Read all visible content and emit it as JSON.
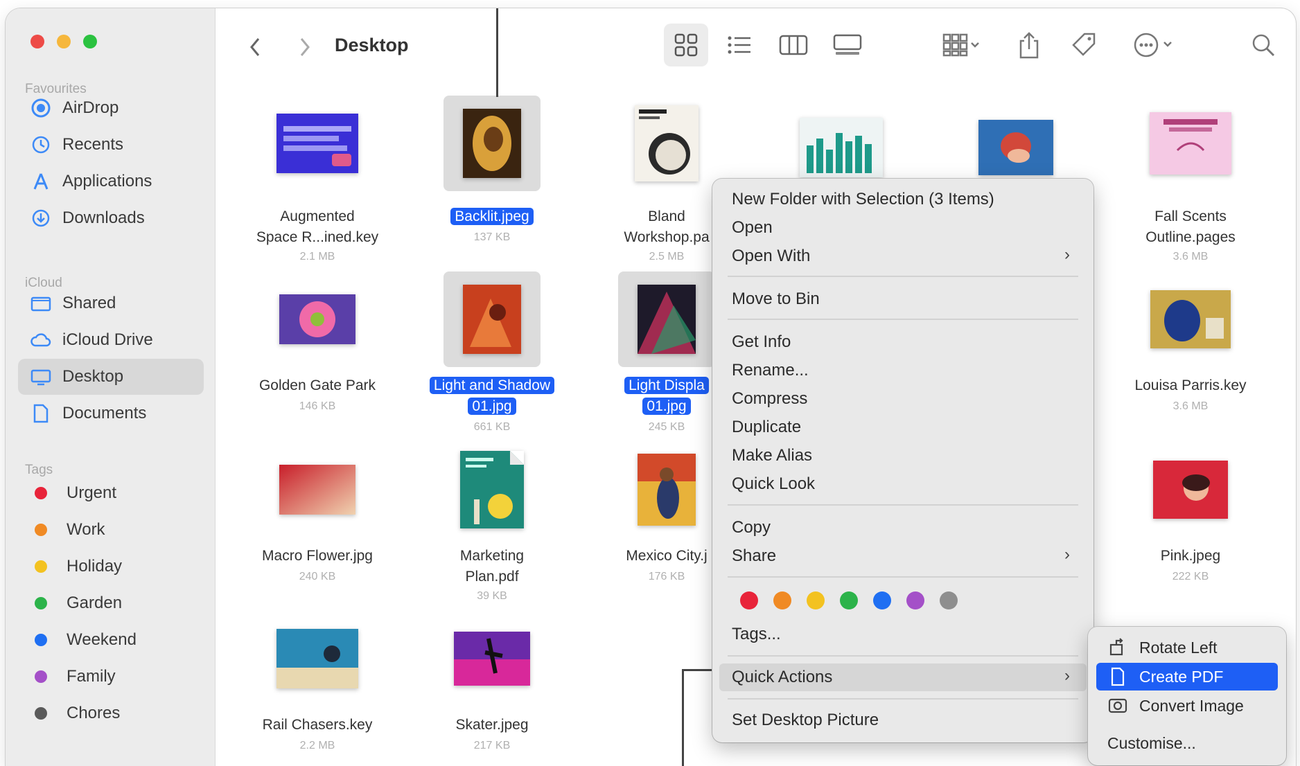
{
  "window": {
    "title": "Desktop",
    "traffic_lights": [
      "#ed4b47",
      "#f6b73c",
      "#2bc240"
    ]
  },
  "sidebar": {
    "favourites_heading": "Favourites",
    "favourites": [
      {
        "label": "AirDrop",
        "icon": "airdrop-icon"
      },
      {
        "label": "Recents",
        "icon": "clock-icon"
      },
      {
        "label": "Applications",
        "icon": "applications-icon"
      },
      {
        "label": "Downloads",
        "icon": "download-icon"
      }
    ],
    "icloud_heading": "iCloud",
    "icloud": [
      {
        "label": "Shared",
        "icon": "shared-folder-icon"
      },
      {
        "label": "iCloud Drive",
        "icon": "cloud-icon"
      },
      {
        "label": "Desktop",
        "icon": "desktop-icon",
        "selected": true
      },
      {
        "label": "Documents",
        "icon": "document-icon"
      }
    ],
    "tags_heading": "Tags",
    "tags": [
      {
        "label": "Urgent",
        "color": "#e8243a"
      },
      {
        "label": "Work",
        "color": "#f08a24"
      },
      {
        "label": "Holiday",
        "color": "#f3c220"
      },
      {
        "label": "Garden",
        "color": "#2cb34a"
      },
      {
        "label": "Weekend",
        "color": "#1f6ff2"
      },
      {
        "label": "Family",
        "color": "#a450c8"
      },
      {
        "label": "Chores",
        "color": "#5a5a5a"
      }
    ]
  },
  "files": [
    {
      "name": "Augmented Space R...ined.key",
      "name_lines": [
        "Augmented",
        "Space R...ined.key"
      ],
      "size": "2.1 MB",
      "selected": false
    },
    {
      "name": "Backlit.jpeg",
      "name_lines": [
        "Backlit.jpeg"
      ],
      "size": "137 KB",
      "selected": true
    },
    {
      "name": "Bland Workshop.pa",
      "name_lines": [
        "Bland",
        "Workshop.pa"
      ],
      "size": "2.5 MB",
      "selected": false
    },
    {
      "name": "Fall Scents Outline.pages",
      "name_lines": [
        "Fall Scents",
        "Outline.pages"
      ],
      "size": "3.6 MB",
      "selected": false
    },
    {
      "name": "Golden Gate Park",
      "name_lines": [
        "Golden Gate Park"
      ],
      "size": "146 KB",
      "selected": false
    },
    {
      "name": "Light and Shadow 01.jpg",
      "name_lines": [
        "Light and Shadow",
        "01.jpg"
      ],
      "size": "661 KB",
      "selected": true
    },
    {
      "name": "Light Displa 01.jpg",
      "name_lines": [
        "Light Displa",
        "01.jpg"
      ],
      "size": "245 KB",
      "selected": true
    },
    {
      "name": "Louisa Parris.key",
      "name_lines": [
        "Louisa Parris.key"
      ],
      "size": "3.6 MB",
      "selected": false
    },
    {
      "name": "Macro Flower.jpg",
      "name_lines": [
        "Macro Flower.jpg"
      ],
      "size": "240 KB",
      "selected": false
    },
    {
      "name": "Marketing Plan.pdf",
      "name_lines": [
        "Marketing",
        "Plan.pdf"
      ],
      "size": "39 KB",
      "selected": false
    },
    {
      "name": "Mexico City.j",
      "name_lines": [
        "Mexico City.j"
      ],
      "size": "176 KB",
      "selected": false
    },
    {
      "name": "Pink.jpeg",
      "name_lines": [
        "Pink.jpeg"
      ],
      "size": "222 KB",
      "selected": false
    },
    {
      "name": "Rail Chasers.key",
      "name_lines": [
        "Rail Chasers.key"
      ],
      "size": "2.2 MB",
      "selected": false
    },
    {
      "name": "Skater.jpeg",
      "name_lines": [
        "Skater.jpeg"
      ],
      "size": "217 KB",
      "selected": false
    }
  ],
  "context_menu": {
    "items": [
      {
        "label": "New Folder with Selection (3 Items)"
      },
      {
        "label": "Open"
      },
      {
        "label": "Open With",
        "submenu": true
      },
      {
        "label": "Move to Bin"
      },
      {
        "label": "Get Info"
      },
      {
        "label": "Rename..."
      },
      {
        "label": "Compress"
      },
      {
        "label": "Duplicate"
      },
      {
        "label": "Make Alias"
      },
      {
        "label": "Quick Look"
      },
      {
        "label": "Copy"
      },
      {
        "label": "Share",
        "submenu": true
      },
      {
        "label": "Tags..."
      },
      {
        "label": "Quick Actions",
        "submenu": true,
        "highlighted": true
      },
      {
        "label": "Set Desktop Picture"
      }
    ],
    "tag_colors": [
      "#e8243a",
      "#f08a24",
      "#f3c220",
      "#2cb34a",
      "#1f6ff2",
      "#a450c8",
      "#8e8e8e"
    ],
    "submenu_arrow": "›"
  },
  "quick_actions_submenu": {
    "items": [
      {
        "label": "Rotate Left",
        "icon": "rotate-left-icon"
      },
      {
        "label": "Create PDF",
        "icon": "pdf-document-icon",
        "active": true
      },
      {
        "label": "Convert Image",
        "icon": "convert-image-icon"
      },
      {
        "label": "Customise..."
      }
    ]
  }
}
